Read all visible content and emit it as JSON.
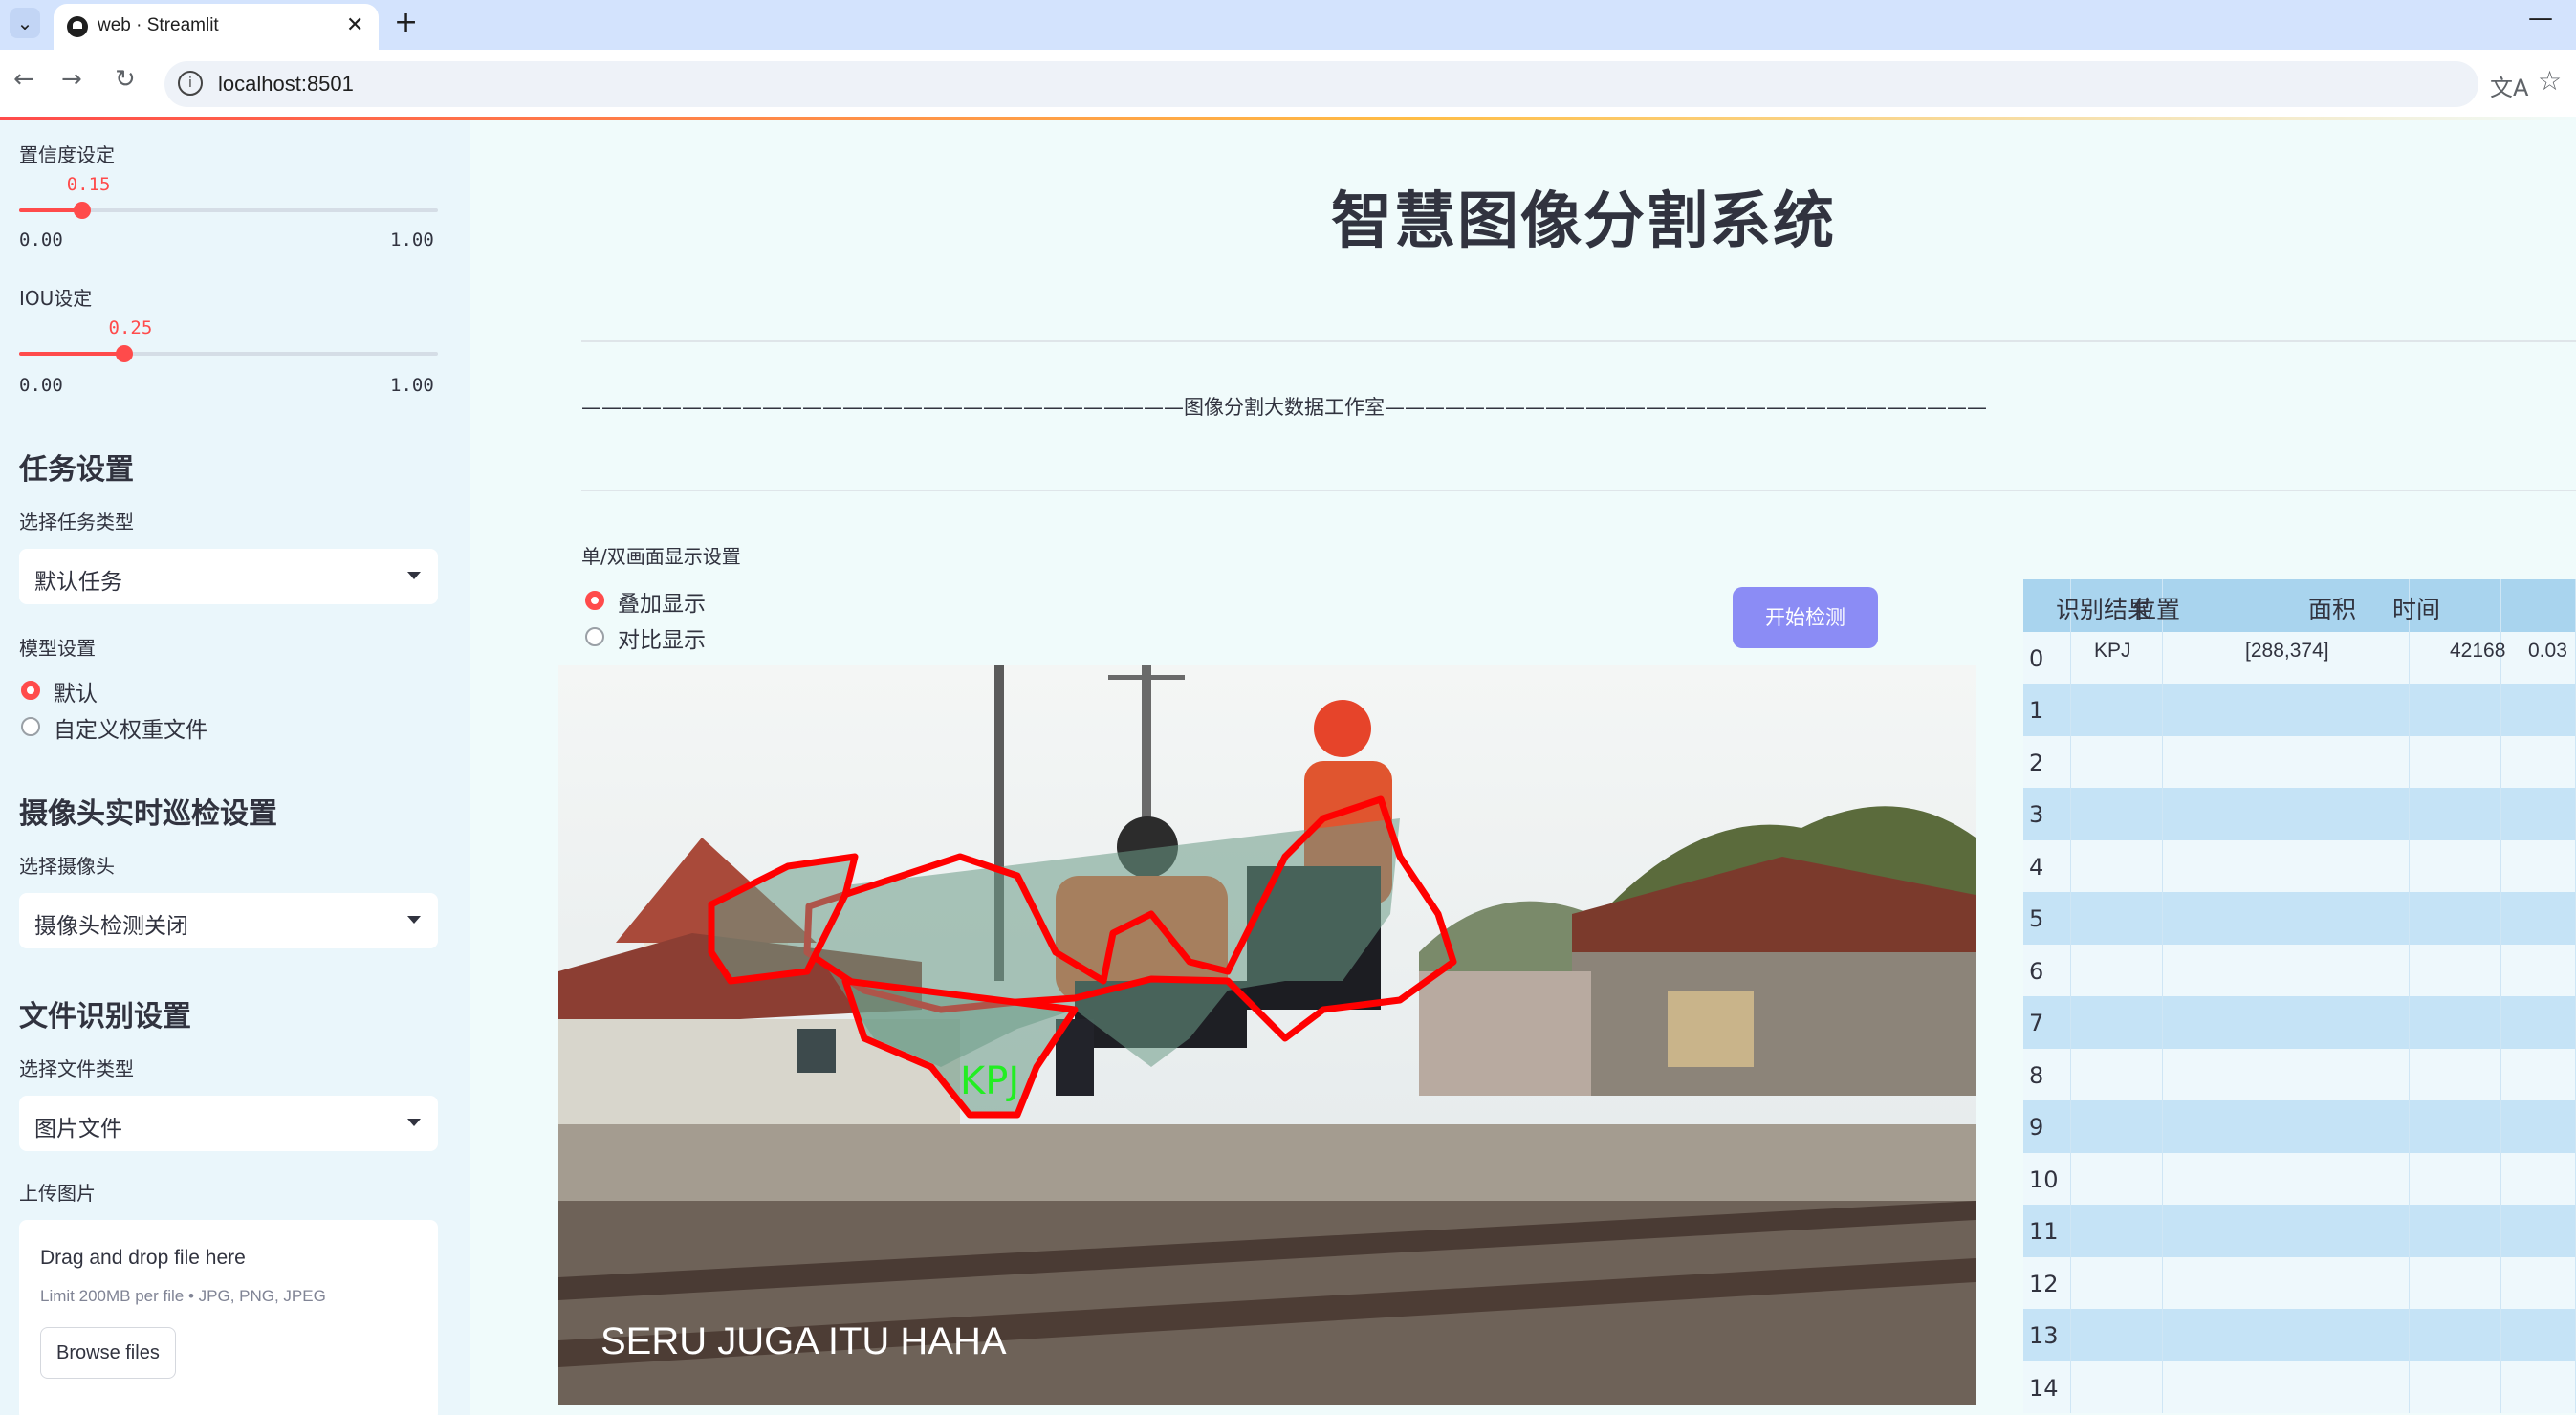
{
  "browser": {
    "tab_title": "web · Streamlit",
    "url": "localhost:8501",
    "tab_menu_icon": "chevron-down-icon",
    "close_tab_icon": "close-icon",
    "new_tab_icon": "plus-icon"
  },
  "sidebar": {
    "confidence": {
      "label": "置信度设定",
      "value": "0.15",
      "min": "0.00",
      "max": "1.00",
      "fraction": 0.15
    },
    "iou": {
      "label": "IOU设定",
      "value": "0.25",
      "min": "0.00",
      "max": "1.00",
      "fraction": 0.25
    },
    "task_heading": "任务设置",
    "task_type_label": "选择任务类型",
    "task_type_value": "默认任务",
    "model_label": "模型设置",
    "model_options": [
      "默认",
      "自定义权重文件"
    ],
    "camera_heading": "摄像头实时巡检设置",
    "camera_label": "选择摄像头",
    "camera_value": "摄像头检测关闭",
    "file_heading": "文件识别设置",
    "file_type_label": "选择文件类型",
    "file_type_value": "图片文件",
    "upload_label": "上传图片",
    "upload_title": "Drag and drop file here",
    "upload_limit": "Limit 200MB per file • JPG, PNG, JPEG",
    "upload_button": "Browse files"
  },
  "main": {
    "title": "智慧图像分割系统",
    "divider_text": "——————————————————————————————图像分割大数据工作室——————————————————————————————",
    "mode_label": "单/双画面显示设置",
    "mode_options": [
      "叠加显示",
      "对比显示"
    ],
    "start_button": "开始检测",
    "image": {
      "detection_label": "KPJ",
      "caption": "SERU JUGA ITU HAHA"
    }
  },
  "results_table": {
    "columns": [
      "识别结果",
      "位置",
      "面积",
      "时间"
    ],
    "row_indices": [
      "0",
      "1",
      "2",
      "3",
      "4",
      "5",
      "6",
      "7",
      "8",
      "9",
      "10",
      "11",
      "12",
      "13",
      "14"
    ],
    "rows": [
      {
        "result": "KPJ",
        "position": "[288,374]",
        "area": "42168",
        "time": "0.03"
      }
    ]
  },
  "colors": {
    "accent": "#ff4b4b",
    "button": "#8b8cf5",
    "table_header": "#a9d4ee",
    "table_stripe": "#c5e3f6",
    "sidebar_bg": "#eaf6fb",
    "page_bg": "#f0fbfb",
    "mask_outline": "#ff0000",
    "mask_label": "#22ee22"
  }
}
